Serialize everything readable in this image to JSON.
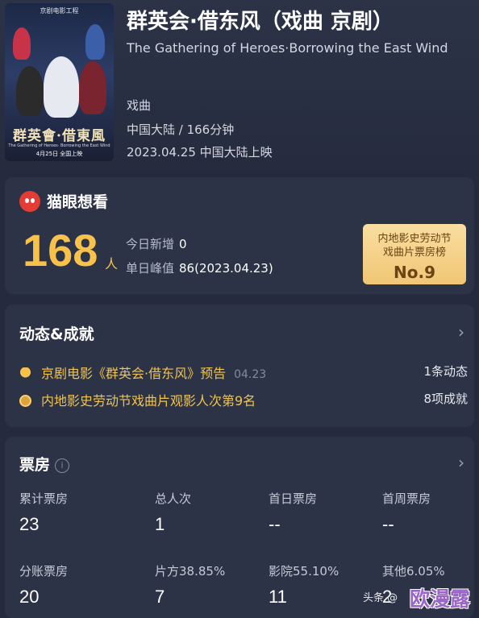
{
  "movie": {
    "title_zh": "群英会·借东风（戏曲 京剧）",
    "title_en": "The Gathering of Heroes·Borrowing the East Wind",
    "genre": "戏曲",
    "region_duration": "中国大陆 / 166分钟",
    "release": "2023.04.25 中国大陆上映"
  },
  "poster": {
    "top_text": "京剧电影工程",
    "title": "群英會·借東風",
    "subtitle": "The Gathering of Heroes· Borrowing the East Wind",
    "date": "4月25日 全国上映"
  },
  "want": {
    "label": "猫眼想看",
    "count": "168",
    "unit": "人",
    "today_label": "今日新增",
    "today_value": "0",
    "peak_label": "单日峰值",
    "peak_value": "86(2023.04.23)",
    "rank_line1": "内地影史劳动节",
    "rank_line2": "戏曲片票房榜",
    "rank_no": "No.9"
  },
  "dynamics": {
    "title": "动态&成就",
    "items": [
      {
        "icon": "bell-icon",
        "text": "京剧电影《群英会·借东风》预告",
        "date": "04.23",
        "right": "1条动态"
      },
      {
        "icon": "medal-icon",
        "text": "内地影史劳动节戏曲片观影人次第9名",
        "date": "",
        "right": "8项成就"
      }
    ]
  },
  "boxoffice": {
    "title": "票房",
    "info": "i",
    "row1": [
      {
        "label": "累计票房",
        "value": "23"
      },
      {
        "label": "总人次",
        "value": "1"
      },
      {
        "label": "首日票房",
        "value": "--"
      },
      {
        "label": "首周票房",
        "value": "--"
      }
    ],
    "row2": [
      {
        "label": "分账票房",
        "value": "20"
      },
      {
        "label": "片方38.85%",
        "value": "7"
      },
      {
        "label": "影院55.10%",
        "value": "11"
      },
      {
        "label": "其他6.05%",
        "value": "2"
      }
    ]
  },
  "watermark": {
    "source": "头条 @",
    "brand": "欧漫露"
  },
  "colors": {
    "background": "#252b3d",
    "card": "#2c3346",
    "accent_gold": "#f6c24c",
    "maoyan_red": "#e43b35"
  }
}
